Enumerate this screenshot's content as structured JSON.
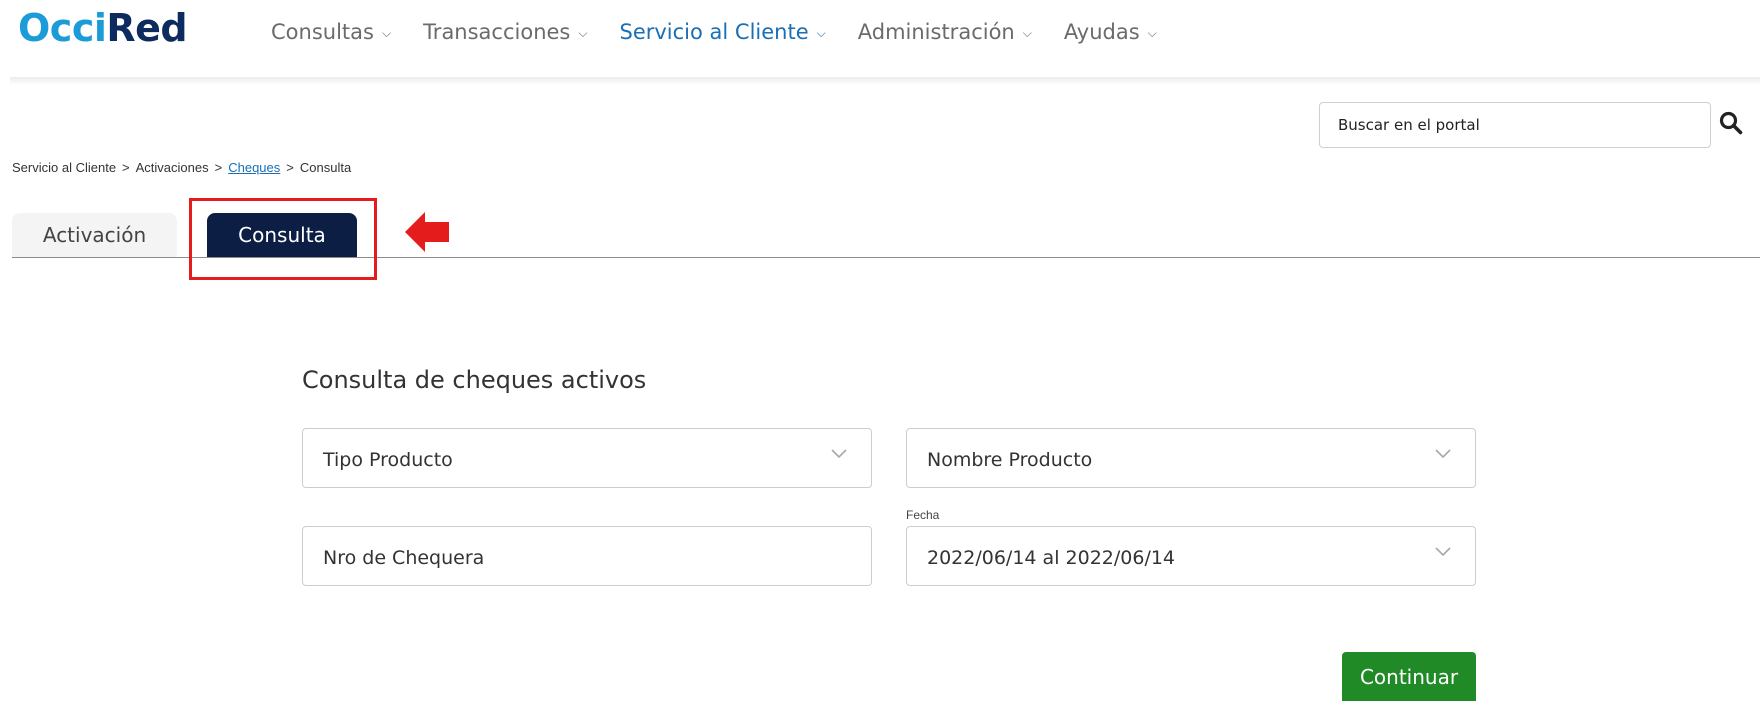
{
  "brand": {
    "logo_part1": "Occi",
    "logo_part2": "Red",
    "accent_blue": "#1b9bd8",
    "navy": "#0d2b5e"
  },
  "nav": {
    "items": [
      {
        "label": "Consultas",
        "icon": "chevron-down-icon"
      },
      {
        "label": "Transacciones",
        "icon": "chevron-down-icon"
      },
      {
        "label": "Servicio al Cliente",
        "icon": "chevron-down-icon"
      },
      {
        "label": "Administración",
        "icon": "chevron-down-icon"
      },
      {
        "label": "Ayudas",
        "icon": "chevron-down-icon"
      }
    ],
    "active_color": "#1a6fb5"
  },
  "search": {
    "placeholder": "Buscar en el portal",
    "icon": "search-icon"
  },
  "breadcrumb": {
    "items": [
      "Servicio al Cliente",
      "Activaciones",
      "Cheques",
      "Consulta"
    ],
    "separator": ">"
  },
  "tabs": {
    "activacion": "Activación",
    "consulta": "Consulta",
    "active_color": "#0d1e45"
  },
  "annotation": {
    "highlight_color": "#e51c1c",
    "arrow": "left-arrow-icon"
  },
  "form": {
    "title": "Consulta de cheques activos",
    "tipo_producto": "Tipo Producto",
    "nombre_producto": "Nombre Producto",
    "nro_chequera": "Nro de Chequera",
    "fecha_label": "Fecha",
    "fecha_value": "2022/06/14 al 2022/06/14",
    "submit_label": "Continuar",
    "submit_color": "#1f8a26"
  }
}
